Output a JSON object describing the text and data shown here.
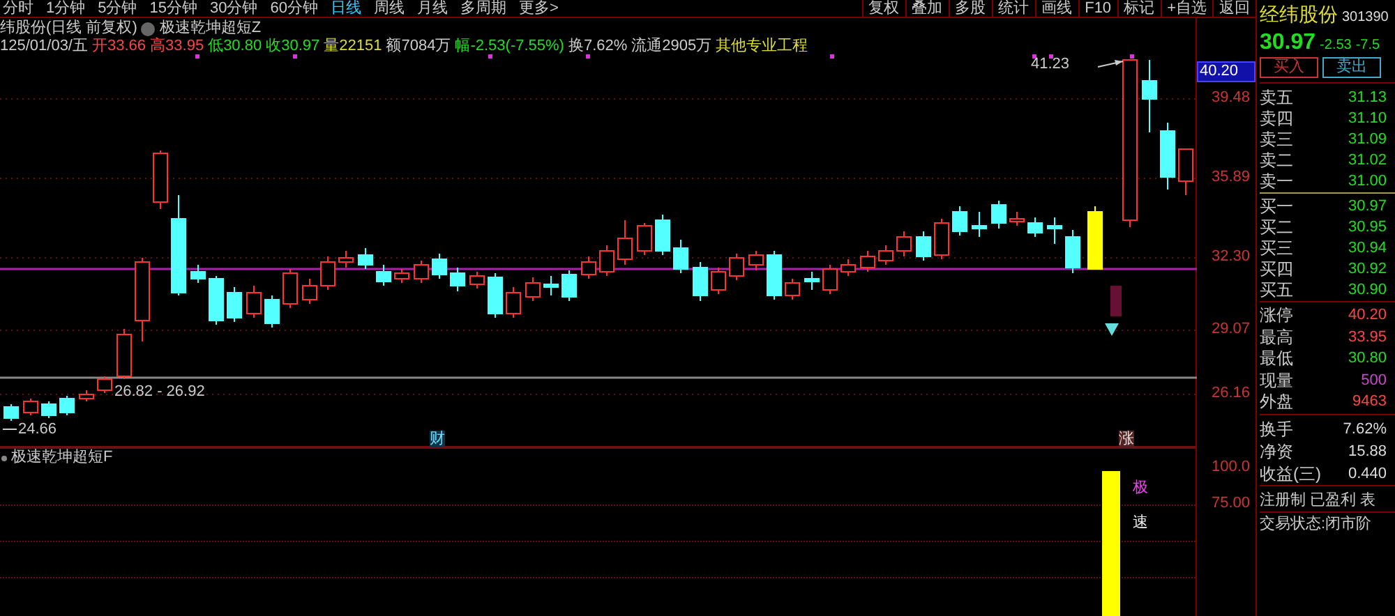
{
  "toolbar": {
    "periods": [
      {
        "label": "分时",
        "selected": false
      },
      {
        "label": "1分钟",
        "selected": false
      },
      {
        "label": "5分钟",
        "selected": false
      },
      {
        "label": "15分钟",
        "selected": false
      },
      {
        "label": "30分钟",
        "selected": false
      },
      {
        "label": "60分钟",
        "selected": false
      },
      {
        "label": "日线",
        "selected": true
      },
      {
        "label": "周线",
        "selected": false
      },
      {
        "label": "月线",
        "selected": false
      },
      {
        "label": "多周期",
        "selected": false
      },
      {
        "label": "更多>",
        "selected": false
      }
    ],
    "buttons": [
      "复权",
      "叠加",
      "多股",
      "统计",
      "画线",
      "F10",
      "标记",
      "+自选",
      "返回"
    ]
  },
  "chart": {
    "title": "纬股份(日线 前复权)",
    "indicator": "极速乾坤超短Z",
    "date": "125/01/03/五",
    "stats": [
      {
        "label": "开",
        "value": "33.66",
        "color": "#ff4444"
      },
      {
        "label": "高",
        "value": "33.95",
        "color": "#ff4444"
      },
      {
        "label": "低",
        "value": "30.80",
        "color": "#22dd22"
      },
      {
        "label": "收",
        "value": "30.97",
        "color": "#22dd22"
      },
      {
        "label": "量",
        "value": "22151",
        "color": "#dddd33"
      },
      {
        "label": "额",
        "value": "7084万",
        "color": "#cccccc"
      },
      {
        "label": "幅",
        "value": "-2.53(-7.55%)",
        "color": "#22dd22"
      },
      {
        "label": "换",
        "value": "7.62%",
        "color": "#cccccc"
      },
      {
        "label": "流通",
        "value": "2905万",
        "color": "#cccccc"
      }
    ],
    "sector": "其他专业工程",
    "price_axis": [
      {
        "label": "40.20",
        "highlighted": true
      },
      {
        "label": "39.48",
        "highlighted": false
      },
      {
        "label": "35.89",
        "highlighted": false
      },
      {
        "label": "32.30",
        "highlighted": false
      },
      {
        "label": "29.07",
        "highlighted": false
      },
      {
        "label": "26.16",
        "highlighted": false
      }
    ],
    "high_label": "41.23",
    "range_label": "26.82 - 26.92",
    "low_label": "24.66",
    "markers": [
      "财",
      "涨"
    ]
  },
  "indicator_panel": {
    "title": "极速乾坤超短F",
    "signal_chars": [
      "极",
      "速"
    ],
    "axis": [
      "100.0",
      "75.00"
    ]
  },
  "quote": {
    "name": "经纬股份",
    "code": "301390",
    "price": "30.97",
    "change": "-2.53",
    "change_pct": "-7.5",
    "buttons": [
      {
        "label": "买入",
        "color": "#cc3333"
      },
      {
        "label": "卖出",
        "color": "#44aacc"
      }
    ],
    "asks": [
      {
        "label": "卖五",
        "value": "31.13"
      },
      {
        "label": "卖四",
        "value": "31.10"
      },
      {
        "label": "卖三",
        "value": "31.09"
      },
      {
        "label": "卖二",
        "value": "31.02"
      },
      {
        "label": "卖一",
        "value": "31.00"
      }
    ],
    "bids": [
      {
        "label": "买一",
        "value": "30.97"
      },
      {
        "label": "买二",
        "value": "30.95"
      },
      {
        "label": "买三",
        "value": "30.94"
      },
      {
        "label": "买四",
        "value": "30.92"
      },
      {
        "label": "买五",
        "value": "30.90"
      }
    ],
    "stats": [
      {
        "label": "涨停",
        "value": "40.20",
        "color": "#ff4444"
      },
      {
        "label": "最高",
        "value": "33.95",
        "color": "#ff4444"
      },
      {
        "label": "最低",
        "value": "30.80",
        "color": "#22dd22"
      },
      {
        "label": "现量",
        "value": "500",
        "color": "#cc44cc"
      },
      {
        "label": "外盘",
        "value": "9463",
        "color": "#ff4444"
      }
    ],
    "finance": [
      {
        "label": "换手",
        "value": "7.62%"
      },
      {
        "label": "净资",
        "value": "15.88"
      },
      {
        "label": "收益(三)",
        "value": "0.440"
      }
    ],
    "tags": "注册制 已盈利 表",
    "status": "交易状态:闭市阶"
  }
}
